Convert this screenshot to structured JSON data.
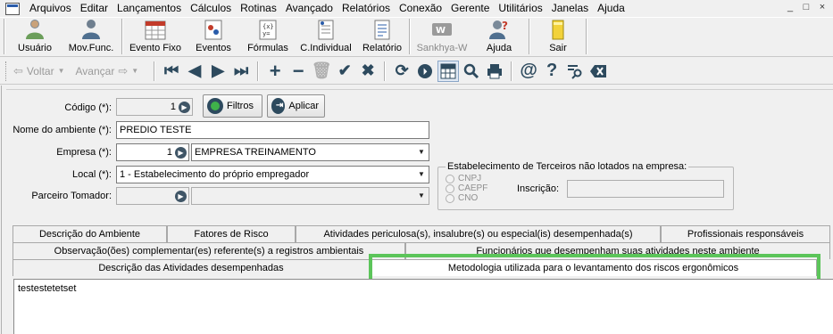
{
  "menubar": {
    "items": [
      "Arquivos",
      "Editar",
      "Lançamentos",
      "Cálculos",
      "Rotinas",
      "Avançado",
      "Relatórios",
      "Conexão",
      "Gerente",
      "Utilitários",
      "Janelas",
      "Ajuda"
    ],
    "window_controls": [
      "_",
      "□",
      "×"
    ]
  },
  "toolbar1": {
    "buttons": [
      {
        "label": "Usuário",
        "icon": "users-icon"
      },
      {
        "label": "Mov.Func.",
        "icon": "employee-move-icon"
      },
      {
        "label": "Evento Fixo",
        "icon": "calendar-icon"
      },
      {
        "label": "Eventos",
        "icon": "events-icon"
      },
      {
        "label": "Fórmulas",
        "icon": "formula-icon"
      },
      {
        "label": "C.Individual",
        "icon": "individual-calc-icon"
      },
      {
        "label": "Relatório",
        "icon": "report-icon"
      },
      {
        "label": "Sankhya-W",
        "icon": "sankhya-logo-icon",
        "disabled": true
      },
      {
        "label": "Ajuda",
        "icon": "help-icon"
      },
      {
        "label": "Sair",
        "icon": "exit-icon"
      }
    ]
  },
  "toolbar2": {
    "back_label": "Voltar",
    "forward_label": "Avançar"
  },
  "form": {
    "codigo_label": "Código (*):",
    "codigo_value": "1",
    "filtros_label": "Filtros",
    "aplicar_label": "Aplicar",
    "nome_label": "Nome do ambiente (*):",
    "nome_value": "PREDIO TESTE",
    "empresa_label": "Empresa (*):",
    "empresa_code": "1",
    "empresa_name": "EMPRESA TREINAMENTO",
    "local_label": "Local (*):",
    "local_value": "1 - Estabelecimento do próprio empregador",
    "parceiro_label": "Parceiro Tomador:",
    "parceiro_value": "",
    "terceiros_title": "Estabelecimento de Terceiros não lotados na empresa:",
    "radio_options": [
      "CNPJ",
      "CAEPF",
      "CNO"
    ],
    "inscricao_label": "Inscrição:"
  },
  "tabs": {
    "row1": [
      "Descrição do Ambiente",
      "Fatores de Risco",
      "Atividades periculosa(s), insalubre(s) ou especial(is) desempenhada(s)",
      "Profissionais responsáveis"
    ],
    "row2": [
      "Observação(ões) complementar(es) referente(s) a registros ambientais",
      "Funcionários que desempenham suas atividades neste ambiente"
    ],
    "row3": [
      "Descrição das Atividades desempenhadas",
      "Metodologia utilizada para o levantamento dos riscos ergonômicos"
    ]
  },
  "content": {
    "text": "testestetetset"
  },
  "colors": {
    "highlight": "#5cc55a",
    "tool_icon": "#2d4a5e"
  }
}
